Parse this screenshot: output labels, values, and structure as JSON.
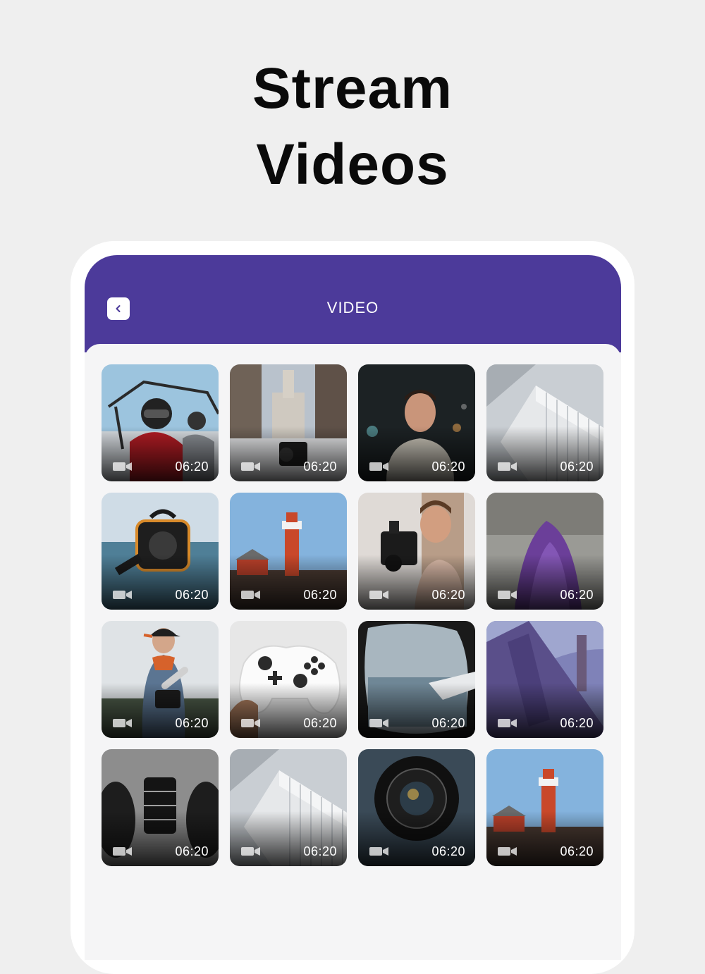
{
  "headline": {
    "line1": "Stream",
    "line2": "Videos"
  },
  "appbar": {
    "title": "VIDEO",
    "back_icon": "chevron-left-icon"
  },
  "colors": {
    "accent": "#4c3a9a",
    "background": "#efefef",
    "content_bg": "#f5f5f6"
  },
  "videos": [
    {
      "scene": "atv-riders",
      "duration": "06:20"
    },
    {
      "scene": "city-hall-camera",
      "duration": "06:20"
    },
    {
      "scene": "portrait-night",
      "duration": "06:20"
    },
    {
      "scene": "building-angle",
      "duration": "06:20"
    },
    {
      "scene": "underwater-housing",
      "duration": "06:20"
    },
    {
      "scene": "lighthouse",
      "duration": "06:20"
    },
    {
      "scene": "cinema-camera-man",
      "duration": "06:20"
    },
    {
      "scene": "purple-veil",
      "duration": "06:20"
    },
    {
      "scene": "man-with-camera",
      "duration": "06:20"
    },
    {
      "scene": "game-controller",
      "duration": "06:20"
    },
    {
      "scene": "plane-window",
      "duration": "06:20"
    },
    {
      "scene": "cinema-sign",
      "duration": "06:20"
    },
    {
      "scene": "lens-shoes",
      "duration": "06:20"
    },
    {
      "scene": "building-angle",
      "duration": "06:20"
    },
    {
      "scene": "wide-lens",
      "duration": "06:20"
    },
    {
      "scene": "lighthouse",
      "duration": "06:20"
    }
  ]
}
